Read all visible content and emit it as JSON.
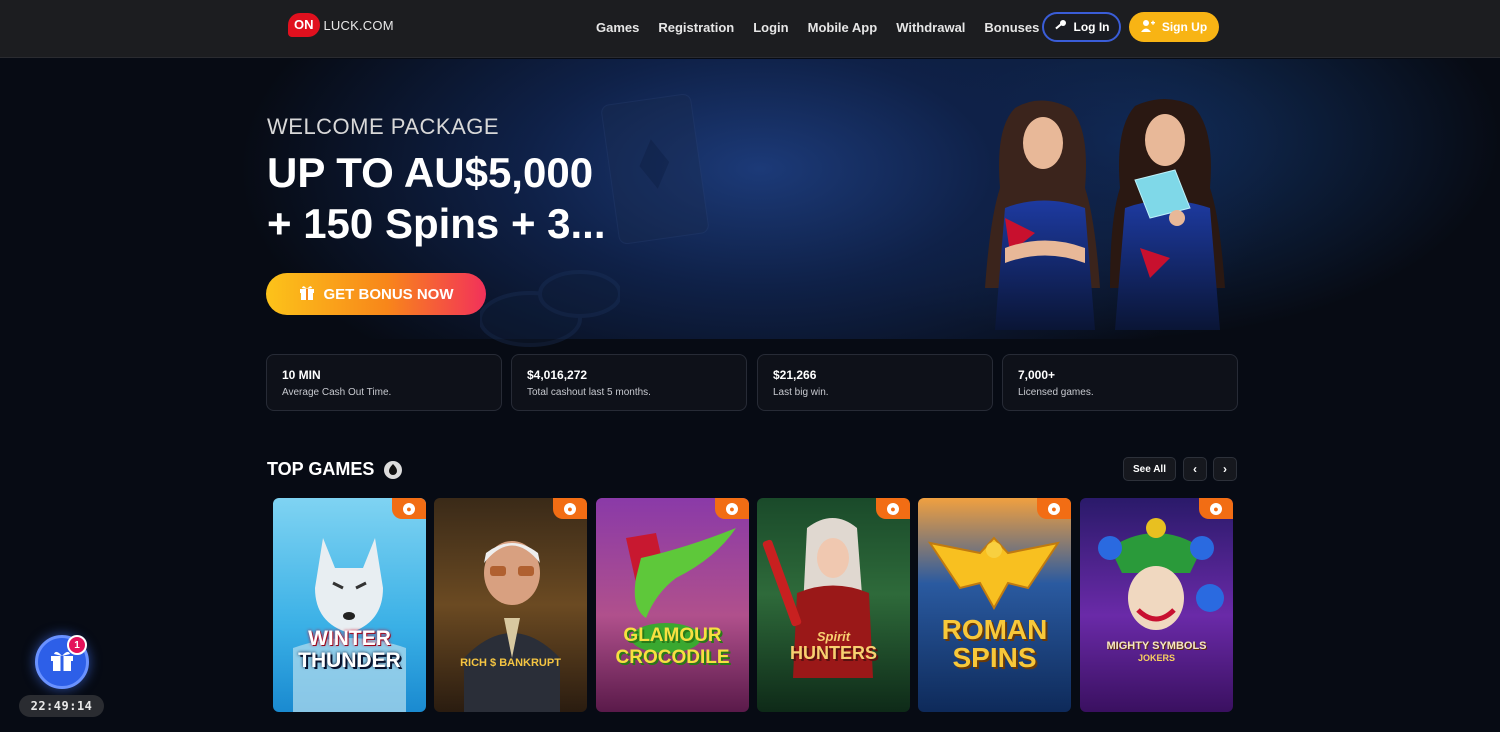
{
  "header": {
    "logo_badge": "ON",
    "logo_text": "LUCK.COM",
    "nav": [
      "Games",
      "Registration",
      "Login",
      "Mobile App",
      "Withdrawal",
      "Bonuses"
    ],
    "login_label": "Log In",
    "signup_label": "Sign Up"
  },
  "hero": {
    "welcome": "WELCOME PACKAGE",
    "amount": "UP TO AU$5,000",
    "spins": "+ 150 Spins + 3...",
    "cta_label": "GET BONUS NOW"
  },
  "stats": [
    {
      "value": "10 MIN",
      "label": "Average Cash Out Time."
    },
    {
      "value": "$4,016,272",
      "label": "Total cashout last 5 months."
    },
    {
      "value": "$21,266",
      "label": "Last big win."
    },
    {
      "value": "7,000+",
      "label": "Licensed games."
    }
  ],
  "top_games": {
    "title": "TOP GAMES",
    "see_all": "See All",
    "prev": "‹",
    "next": "›",
    "games": [
      {
        "line1": "WINTER",
        "line2": "THUNDER"
      },
      {
        "line1": "RICH",
        "line2": "BANKRUPT"
      },
      {
        "line1": "GLAMOUR",
        "line2": "CROCODILE"
      },
      {
        "line1": "Spirit",
        "line2": "HUNTERS"
      },
      {
        "line1": "ROMAN",
        "line2": "SPINS"
      },
      {
        "line1": "MIGHTY SYMBOLS",
        "line2": "JOKERS"
      }
    ]
  },
  "widget": {
    "badge": "1",
    "timer": "22:49:14"
  },
  "colors": {
    "accent_yellow": "#f8b414",
    "login_border": "#3a5dd8",
    "hot_badge": "#f26d14",
    "brand_red": "#e0101e"
  },
  "icons": [
    "key-icon",
    "user-plus-icon",
    "gift-icon",
    "fire-icon",
    "chevron-down-icon"
  ]
}
